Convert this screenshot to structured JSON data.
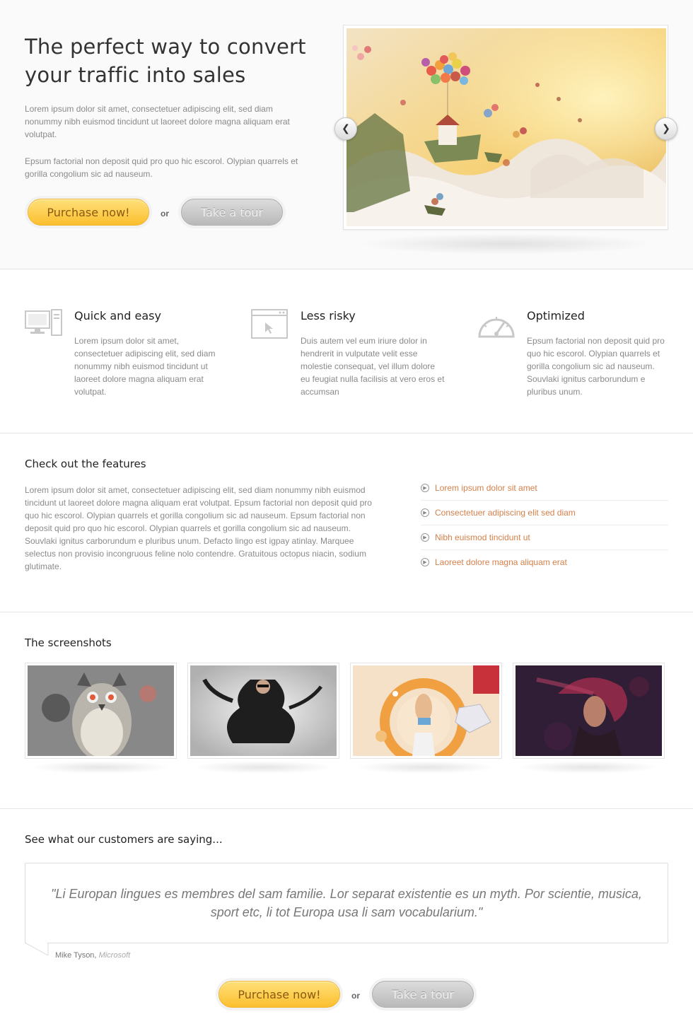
{
  "hero": {
    "title": "The perfect way to convert your traffic into sales",
    "paragraph1": "Lorem ipsum dolor sit amet, consectetuer adipiscing elit, sed diam nonummy nibh euismod tincidunt ut laoreet dolore magna aliquam erat volutpat.",
    "paragraph2": "Epsum factorial non deposit quid pro quo hic escorol. Olypian quarrels et gorilla congolium sic ad nauseum.",
    "purchase_label": "Purchase now!",
    "or_label": "or",
    "tour_label": "Take a tour",
    "slider": {
      "prev_icon": "chevron-left-icon",
      "next_icon": "chevron-right-icon"
    }
  },
  "benefits": [
    {
      "icon": "monitor-icon",
      "title": "Quick and easy",
      "text": "Lorem ipsum dolor sit amet, consectetuer adipiscing elit, sed diam nonummy nibh euismod tincidunt ut laoreet dolore magna aliquam erat volutpat."
    },
    {
      "icon": "browser-cursor-icon",
      "title": "Less risky",
      "text": "Duis autem vel eum iriure dolor in hendrerit in vulputate velit esse molestie consequat, vel illum dolore eu feugiat nulla facilisis at vero eros et accumsan"
    },
    {
      "icon": "speedometer-icon",
      "title": "Optimized",
      "text": "Epsum factorial non deposit quid pro quo hic escorol. Olypian quarrels et gorilla congolium sic ad nauseum. Souvlaki ignitus carborundum e pluribus unum."
    }
  ],
  "features": {
    "heading": "Check out the features",
    "text": "Lorem ipsum dolor sit amet, consectetuer adipiscing elit, sed diam nonummy nibh euismod tincidunt ut laoreet dolore magna aliquam erat volutpat. Epsum factorial non deposit quid pro quo hic escorol. Olypian quarrels et gorilla congolium sic ad nauseum. Epsum factorial non deposit quid pro quo hic escorol. Olypian quarrels et gorilla congolium sic ad nauseum. Souvlaki ignitus carborundum e pluribus unum. Defacto lingo est igpay atinlay. Marquee selectus non provisio incongruous feline nolo contendre. Gratuitous octopus niacin, sodium glutimate.",
    "list": [
      "Lorem ipsum dolor sit amet",
      "Consectetuer adipiscing elit sed diam",
      "Nibh euismod tincidunt ut",
      "Laoreet dolore magna aliquam erat"
    ],
    "link_color": "#d4804a"
  },
  "screenshots": {
    "heading": "The screenshots"
  },
  "testimonial": {
    "heading": "See what our customers are saying...",
    "quote": "\"Li Europan lingues es membres del sam familie. Lor separat existentie es un myth. Por scientie, musica, sport etc, li tot Europa usa li sam vocabularium.\"",
    "author_name": "Mike Tyson,",
    "author_company": "Microsoft"
  },
  "footer_cta": {
    "purchase_label": "Purchase now!",
    "or_label": "or",
    "tour_label": "Take a tour"
  },
  "colors": {
    "accent_yellow": "#fbbf2e",
    "button_gray": "#b9b9b9",
    "link_orange": "#d4804a"
  }
}
